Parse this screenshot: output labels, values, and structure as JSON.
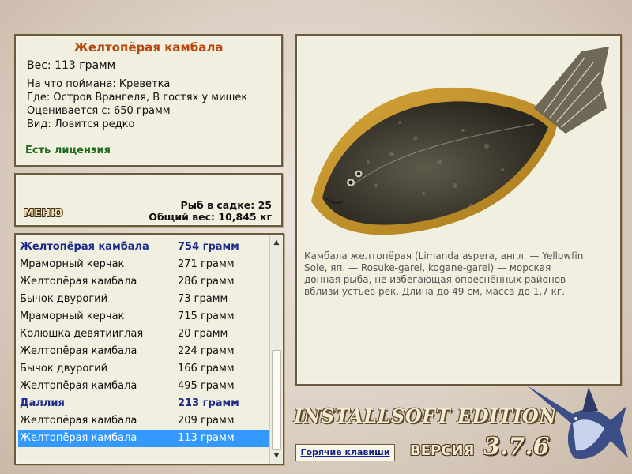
{
  "fish_info": {
    "title": "Желтопёрая камбала",
    "weight": "Вес: 113 грамм",
    "caught_on": "На что поймана: Креветка",
    "location": "Где: Остров Врангеля, В гостях у мишек",
    "valued_from": "Оценивается с: 650 грамм",
    "rarity": "Вид: Ловится редко",
    "license": "Есть лицензия"
  },
  "menu": {
    "button_label": "МЕНЮ",
    "fish_in_keepnet": "Рыб в садке: 25",
    "total_weight": "Общий вес: 10,845 кг"
  },
  "catch_list": [
    {
      "name": "Желтопёрая камбала",
      "weight": "754 грамм",
      "highlight": true
    },
    {
      "name": "Мраморный керчак",
      "weight": "271 грамм"
    },
    {
      "name": "Желтопёрая камбала",
      "weight": "286 грамм"
    },
    {
      "name": "Бычок двурогий",
      "weight": "73 грамм"
    },
    {
      "name": "Мраморный керчак",
      "weight": "715 грамм"
    },
    {
      "name": "Колюшка девятииглая",
      "weight": "20 грамм"
    },
    {
      "name": "Желтопёрая камбала",
      "weight": "224 грамм"
    },
    {
      "name": "Бычок двурогий",
      "weight": "166 грамм"
    },
    {
      "name": "Желтопёрая камбала",
      "weight": "495 грамм"
    },
    {
      "name": "Даллия",
      "weight": "213 грамм",
      "highlight": true
    },
    {
      "name": "Желтопёрая камбала",
      "weight": "209 грамм"
    },
    {
      "name": "Желтопёрая камбала",
      "weight": "113 грамм",
      "selected": true
    }
  ],
  "description": "Камбала желтопёрая (Limanda aspera, англ. — Yellowfin Sole, яп. — Rosuke-garei, kogane-garei) — морская донная рыба, не избегающая опреснённых районов вблизи устьев рек. Длина до 49 см, масса до 1,7 кг.",
  "footer": {
    "hotkeys_label": "Горячие клавиши",
    "edition": "INSTALLSOFT EDITION",
    "version_label": "ВЕРСИЯ",
    "version_number": "3.7.6"
  },
  "icons": {
    "scroll_up": "scroll-up-arrow-icon",
    "scroll_down": "scroll-down-arrow-icon",
    "fish_image": "flounder-image",
    "logo": "marlin-logo-icon"
  },
  "colors": {
    "title": "#b8460e",
    "license": "#1c6b1a",
    "highlight_row": "#1b2a8a",
    "selected_row": "#3399ff",
    "panel_bg": "#f1efdf"
  }
}
